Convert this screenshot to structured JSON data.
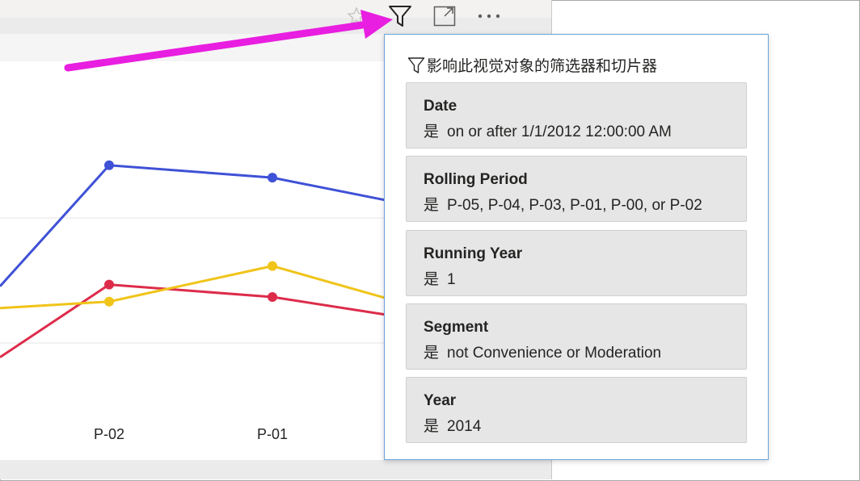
{
  "toolbar": {
    "icons": [
      "pin-icon",
      "filter-icon",
      "focus-mode-icon",
      "more-options-icon"
    ],
    "more_label": "..."
  },
  "tooltip": {
    "header": "影响此视觉对象的筛选器和切片器",
    "filters": [
      {
        "title": "Date",
        "operator": "是",
        "value": "on or after 1/1/2012 12:00:00 AM"
      },
      {
        "title": "Rolling Period",
        "operator": "是",
        "value": "P-05, P-04, P-03, P-01, P-00, or P-02"
      },
      {
        "title": "Running Year",
        "operator": "是",
        "value": "1"
      },
      {
        "title": "Segment",
        "operator": "是",
        "value": "not Convenience or Moderation"
      },
      {
        "title": "Year",
        "operator": "是",
        "value": "2014"
      }
    ]
  },
  "colors": {
    "blue_series": "#3f51d6",
    "red_series": "#dd2c4a",
    "yellow_series": "#f0c419",
    "arrow": "#e81ee0",
    "tooltip_border": "#6aa3d8"
  },
  "chart_data": {
    "type": "line",
    "categories": [
      "P-02",
      "P-01"
    ],
    "series": [
      {
        "color": "#3f51d6",
        "values": [
          185,
          177
        ]
      },
      {
        "color": "#dd2c4a",
        "values": [
          108,
          100
        ]
      },
      {
        "color": "#f0c419",
        "values": [
          97,
          120
        ]
      }
    ],
    "grid": true
  }
}
